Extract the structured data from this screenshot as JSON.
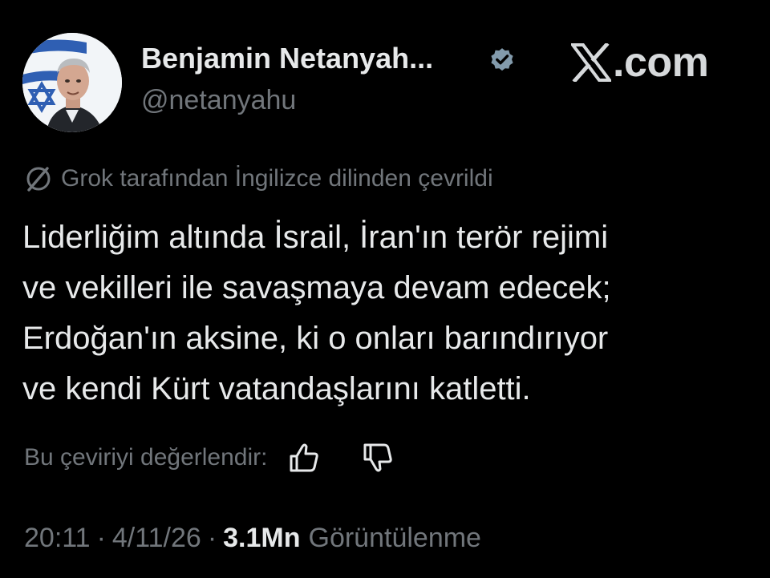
{
  "author": {
    "name": "Benjamin Netanyah...",
    "handle": "@netanyahu",
    "verified_badge_color": "#829aab"
  },
  "brand": {
    "icon": "x-logo-icon",
    "text": ".com"
  },
  "translation": {
    "icon": "no-globe-icon",
    "note": "Grok tarafından İngilizce dilinden çevrildi"
  },
  "tweet": {
    "lines": [
      "Liderliğim altında İsrail, İran'ın terör rejimi",
      "ve vekilleri ile savaşmaya devam edecek;",
      "Erdoğan'ın aksine, ki o onları barındırıyor",
      "ve kendi Kürt vatandaşlarını katletti."
    ]
  },
  "rating": {
    "prompt": "Bu çeviriyi değerlendir:",
    "like_icon": "thumbs-up-icon",
    "dislike_icon": "thumbs-down-icon"
  },
  "meta": {
    "time": "20:11",
    "date": "4/11/26",
    "separator": "·",
    "views_count": "3.1Mn",
    "views_label": "Görüntülenme"
  },
  "colors": {
    "background": "#000000",
    "text": "#e7e9ea",
    "secondary": "#71767b"
  }
}
